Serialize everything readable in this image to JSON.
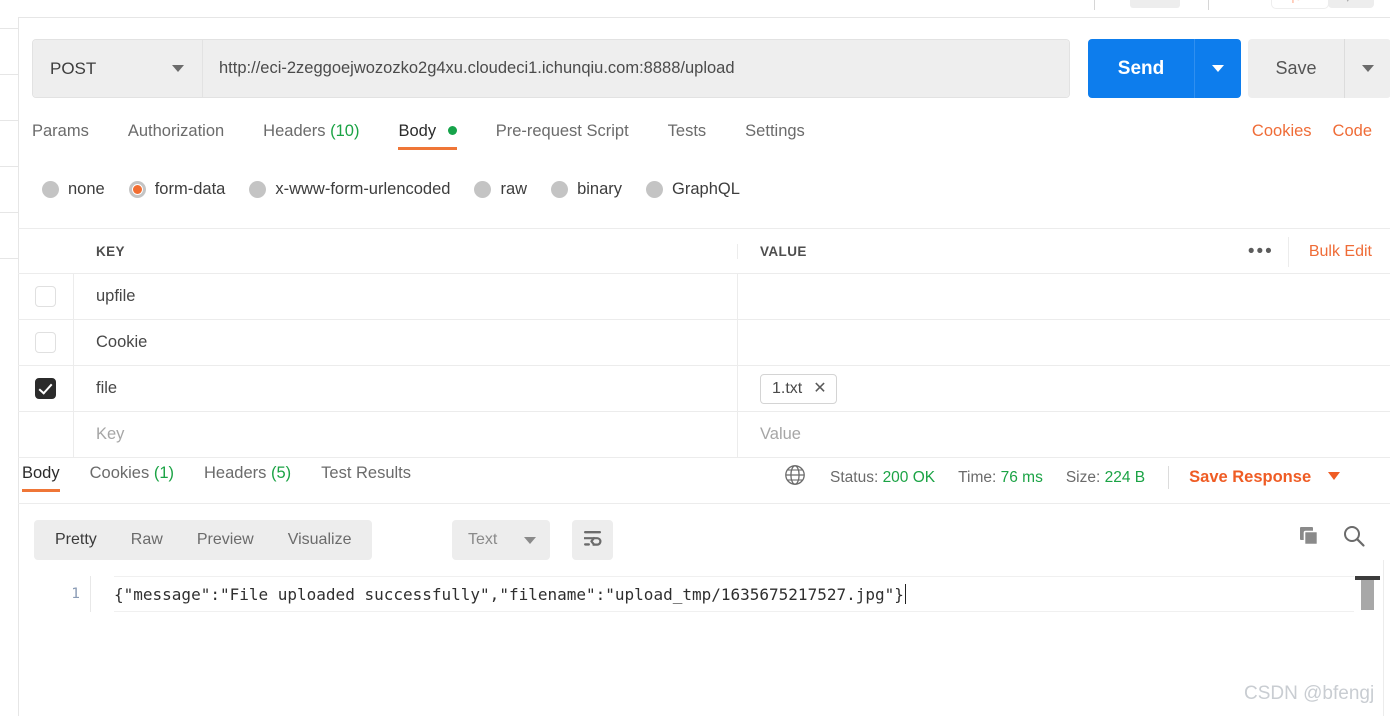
{
  "request": {
    "method": "POST",
    "url": "http://eci-2zeggoejwozozko2g4xu.cloudeci1.ichunqiu.com:8888/upload",
    "send_label": "Send",
    "save_label": "Save",
    "tabs": [
      {
        "label": "Params",
        "count": "",
        "active": false,
        "dot": false
      },
      {
        "label": "Authorization",
        "count": "",
        "active": false,
        "dot": false
      },
      {
        "label": "Headers",
        "count": "(10)",
        "active": false,
        "dot": false
      },
      {
        "label": "Body",
        "count": "",
        "active": true,
        "dot": true
      },
      {
        "label": "Pre-request Script",
        "count": "",
        "active": false,
        "dot": false
      },
      {
        "label": "Tests",
        "count": "",
        "active": false,
        "dot": false
      },
      {
        "label": "Settings",
        "count": "",
        "active": false,
        "dot": false
      }
    ],
    "actions": [
      {
        "label": "Cookies"
      },
      {
        "label": "Code"
      }
    ],
    "body_types": [
      {
        "label": "none",
        "selected": false
      },
      {
        "label": "form-data",
        "selected": true
      },
      {
        "label": "x-www-form-urlencoded",
        "selected": false
      },
      {
        "label": "raw",
        "selected": false
      },
      {
        "label": "binary",
        "selected": false
      },
      {
        "label": "GraphQL",
        "selected": false
      }
    ]
  },
  "kv_table": {
    "headers": {
      "key": "KEY",
      "value": "VALUE"
    },
    "bulk_edit_label": "Bulk Edit",
    "more_label": "•••",
    "rows": [
      {
        "checked": false,
        "key": "upfile",
        "value": "",
        "placeholder": false,
        "chip": false
      },
      {
        "checked": false,
        "key": "Cookie",
        "value": "",
        "placeholder": false,
        "chip": false
      },
      {
        "checked": true,
        "key": "file",
        "value": "1.txt",
        "placeholder": false,
        "chip": true
      },
      {
        "checked": false,
        "key": "Key",
        "value": "Value",
        "placeholder": true,
        "chip": false
      }
    ]
  },
  "response": {
    "tabs": [
      {
        "label": "Body",
        "count": "",
        "active": true
      },
      {
        "label": "Cookies",
        "count": "(1)",
        "active": false
      },
      {
        "label": "Headers",
        "count": "(5)",
        "active": false
      },
      {
        "label": "Test Results",
        "count": "",
        "active": false
      }
    ],
    "status_label": "Status:",
    "status_value": "200 OK",
    "time_label": "Time:",
    "time_value": "76 ms",
    "size_label": "Size:",
    "size_value": "224 B",
    "save_response_label": "Save Response",
    "format_tabs": [
      {
        "label": "Pretty",
        "active": true
      },
      {
        "label": "Raw",
        "active": false
      },
      {
        "label": "Preview",
        "active": false
      },
      {
        "label": "Visualize",
        "active": false
      }
    ],
    "content_type": "Text",
    "line_number": "1",
    "body_text": "{\"message\":\"File uploaded successfully\",\"filename\":\"upload_tmp/1635675217527.jpg\"}"
  },
  "watermark": "CSDN @bfengj",
  "colors": {
    "accent_orange": "#ef6c37",
    "send_blue": "#0d7ded",
    "status_green": "#1ba345"
  }
}
